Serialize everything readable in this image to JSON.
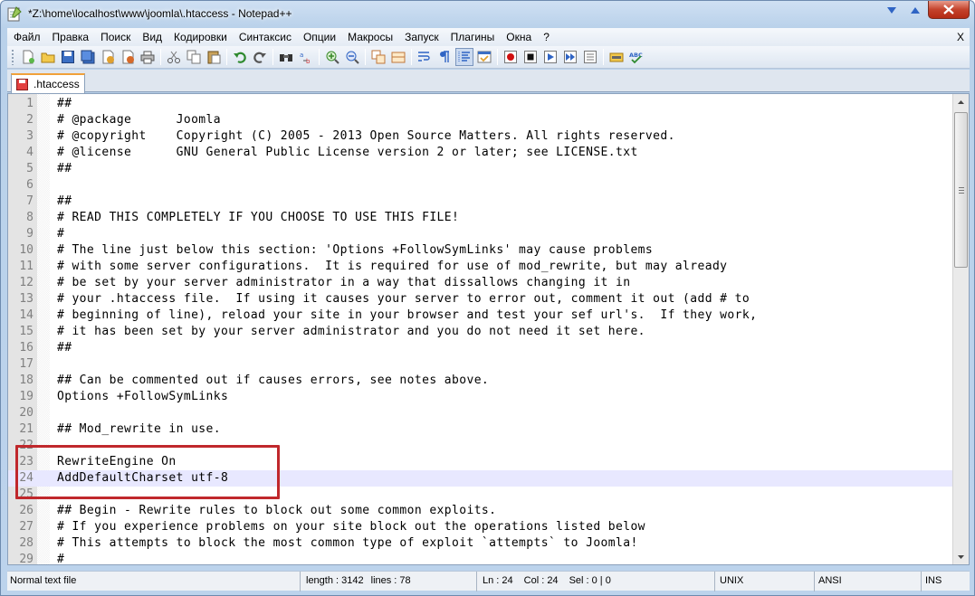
{
  "window": {
    "title": "*Z:\\home\\localhost\\www\\joomla\\.htaccess - Notepad++"
  },
  "menu": [
    "Файл",
    "Правка",
    "Поиск",
    "Вид",
    "Кодировки",
    "Синтаксис",
    "Опции",
    "Макросы",
    "Запуск",
    "Плагины",
    "Окна",
    "?"
  ],
  "menu_close": "X",
  "toolbar_icons": [
    "new-file-icon",
    "open-file-icon",
    "save-icon",
    "save-all-icon",
    "close-icon",
    "close-all-icon",
    "print-icon",
    "cut-icon",
    "copy-icon",
    "paste-icon",
    "undo-icon",
    "redo-icon",
    "find-icon",
    "replace-icon",
    "zoom-in-icon",
    "zoom-out-icon",
    "sync-vertical-icon",
    "sync-horizontal-icon",
    "word-wrap-icon",
    "show-all-chars-icon",
    "indent-guide-icon",
    "user-lang-icon",
    "record-macro-icon",
    "stop-record-icon",
    "play-macro-icon",
    "play-multiple-icon",
    "save-macro-icon",
    "trim-icon",
    "spellcheck-icon"
  ],
  "tab": {
    "label": ".htaccess",
    "color": "#f1a13a"
  },
  "editor": {
    "current_line": 24,
    "lines": [
      "##",
      "# @package      Joomla",
      "# @copyright    Copyright (C) 2005 - 2013 Open Source Matters. All rights reserved.",
      "# @license      GNU General Public License version 2 or later; see LICENSE.txt",
      "##",
      "",
      "##",
      "# READ THIS COMPLETELY IF YOU CHOOSE TO USE THIS FILE!",
      "#",
      "# The line just below this section: 'Options +FollowSymLinks' may cause problems",
      "# with some server configurations.  It is required for use of mod_rewrite, but may already",
      "# be set by your server administrator in a way that dissallows changing it in",
      "# your .htaccess file.  If using it causes your server to error out, comment it out (add # to",
      "# beginning of line), reload your site in your browser and test your sef url's.  If they work,",
      "# it has been set by your server administrator and you do not need it set here.",
      "##",
      "",
      "## Can be commented out if causes errors, see notes above.",
      "Options +FollowSymLinks",
      "",
      "## Mod_rewrite in use.",
      "",
      "RewriteEngine On",
      "AddDefaultCharset utf-8",
      "",
      "## Begin - Rewrite rules to block out some common exploits.",
      "# If you experience problems on your site block out the operations listed below",
      "# This attempts to block the most common type of exploit `attempts` to Joomla!",
      "#"
    ]
  },
  "status": {
    "file_type": "Normal text file",
    "length": "length : 3142",
    "lines": "lines : 78",
    "ln": "Ln : 24",
    "col": "Col : 24",
    "sel": "Sel : 0 | 0",
    "eol": "UNIX",
    "encoding": "ANSI",
    "mode": "INS"
  },
  "colors": {
    "highlight": "#c0282c",
    "current_line": "#e8e8ff"
  }
}
